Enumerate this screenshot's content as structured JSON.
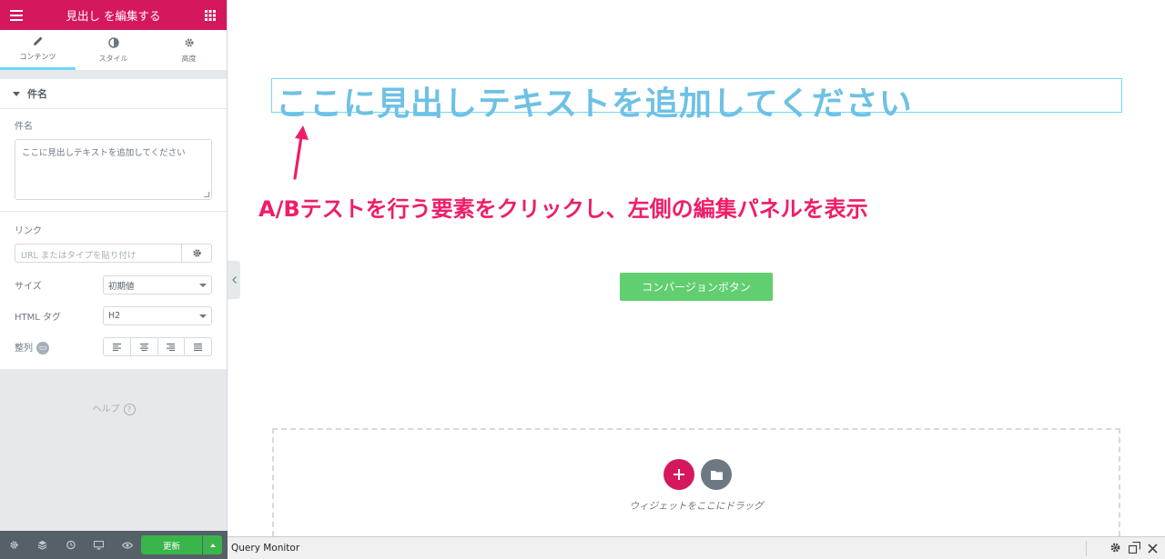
{
  "panel": {
    "header_title": "見出し を編集する",
    "tabs": [
      {
        "label": "コンテンツ",
        "icon": "pencil-icon"
      },
      {
        "label": "スタイル",
        "icon": "contrast-icon"
      },
      {
        "label": "高度",
        "icon": "gear-icon"
      }
    ],
    "section_title": "件名",
    "title_label": "件名",
    "title_value": "ここに見出しテキストを追加してください",
    "link_label": "リンク",
    "link_placeholder": "URL またはタイプを貼り付け",
    "size_label": "サイズ",
    "size_value": "初期値",
    "html_tag_label": "HTML タグ",
    "html_tag_value": "H2",
    "align_label": "整列",
    "help_label": "ヘルプ",
    "help_q": "?"
  },
  "footer": {
    "update_label": "更新"
  },
  "canvas": {
    "heading": "ここに見出しテキストを追加してください",
    "annotation": "A/Bテストを行う要素をクリックし、左側の編集パネルを表示",
    "button_label": "コンバージョンボタン",
    "dropzone_text": "ウィジェットをここにドラッグ"
  },
  "query_monitor": {
    "title": "Query Monitor"
  },
  "colors": {
    "brand": "#d5175e",
    "heading": "#6ec1e4",
    "annotation": "#ef1d6a",
    "button": "#61ce70",
    "update": "#39b54a"
  }
}
